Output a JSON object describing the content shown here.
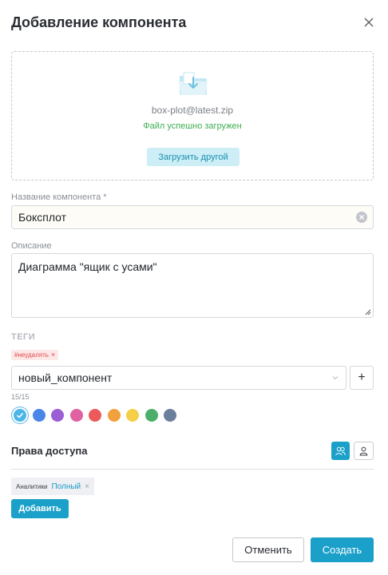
{
  "dialog": {
    "title": "Добавление компонента"
  },
  "upload": {
    "filename": "box-plot@latest.zip",
    "status": "Файл успешно загружен",
    "button_label": "Загрузить другой",
    "status_color": "#3fae52"
  },
  "name_field": {
    "label": "Название компонента",
    "required_mark": "*",
    "value": "Боксплот"
  },
  "description_field": {
    "label": "Описание",
    "value": "Диаграмма \"ящик с усами\""
  },
  "tags": {
    "title": "ТЕГИ",
    "chips": [
      {
        "label": "#неудалять",
        "remove": "×"
      }
    ],
    "select_value": "новый_компонент",
    "add_label": "+",
    "counter": "15/15"
  },
  "colors": {
    "selected": "#4db6e8",
    "options": [
      "#4db6e8",
      "#4a86e8",
      "#9a5ed6",
      "#e062a0",
      "#ec5a5a",
      "#f2a03d",
      "#f5cf47",
      "#4caf69",
      "#6b7e9c"
    ]
  },
  "access": {
    "title": "Права доступа",
    "permissions": [
      {
        "who": "Аналитики",
        "level": "Полный",
        "remove": "×"
      }
    ],
    "add_label": "Добавить"
  },
  "footer": {
    "cancel_label": "Отменить",
    "create_label": "Создать"
  },
  "theme": {
    "accent": "#1aa0c9"
  }
}
